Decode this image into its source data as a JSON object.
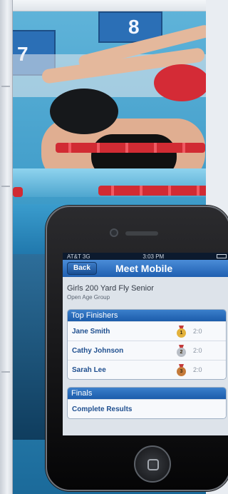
{
  "phone_app": {
    "status": {
      "carrier": "AT&T 3G",
      "time": "3:03 PM"
    },
    "nav": {
      "back_label": "Back",
      "title": "Meet Mobile"
    },
    "event": {
      "title": "Girls 200 Yard Fly Senior",
      "subtitle": "Open Age Group"
    },
    "top_finishers": {
      "header": "Top Finishers",
      "rows": [
        {
          "name": "Jane Smith",
          "medal": "gold",
          "medal_num": "1",
          "time": "2:0"
        },
        {
          "name": "Cathy Johnson",
          "medal": "silver",
          "medal_num": "2",
          "time": "2:0"
        },
        {
          "name": "Sarah Lee",
          "medal": "bronze",
          "medal_num": "3",
          "time": "2:0"
        }
      ]
    },
    "finals": {
      "header": "Finals",
      "link": "Complete Results"
    }
  },
  "photo": {
    "block_numbers": [
      "7",
      "8"
    ]
  },
  "colors": {
    "nav_blue": "#1f5fb0",
    "gold": "#e3b23c",
    "silver": "#b9bec6",
    "bronze": "#c47a3a"
  }
}
